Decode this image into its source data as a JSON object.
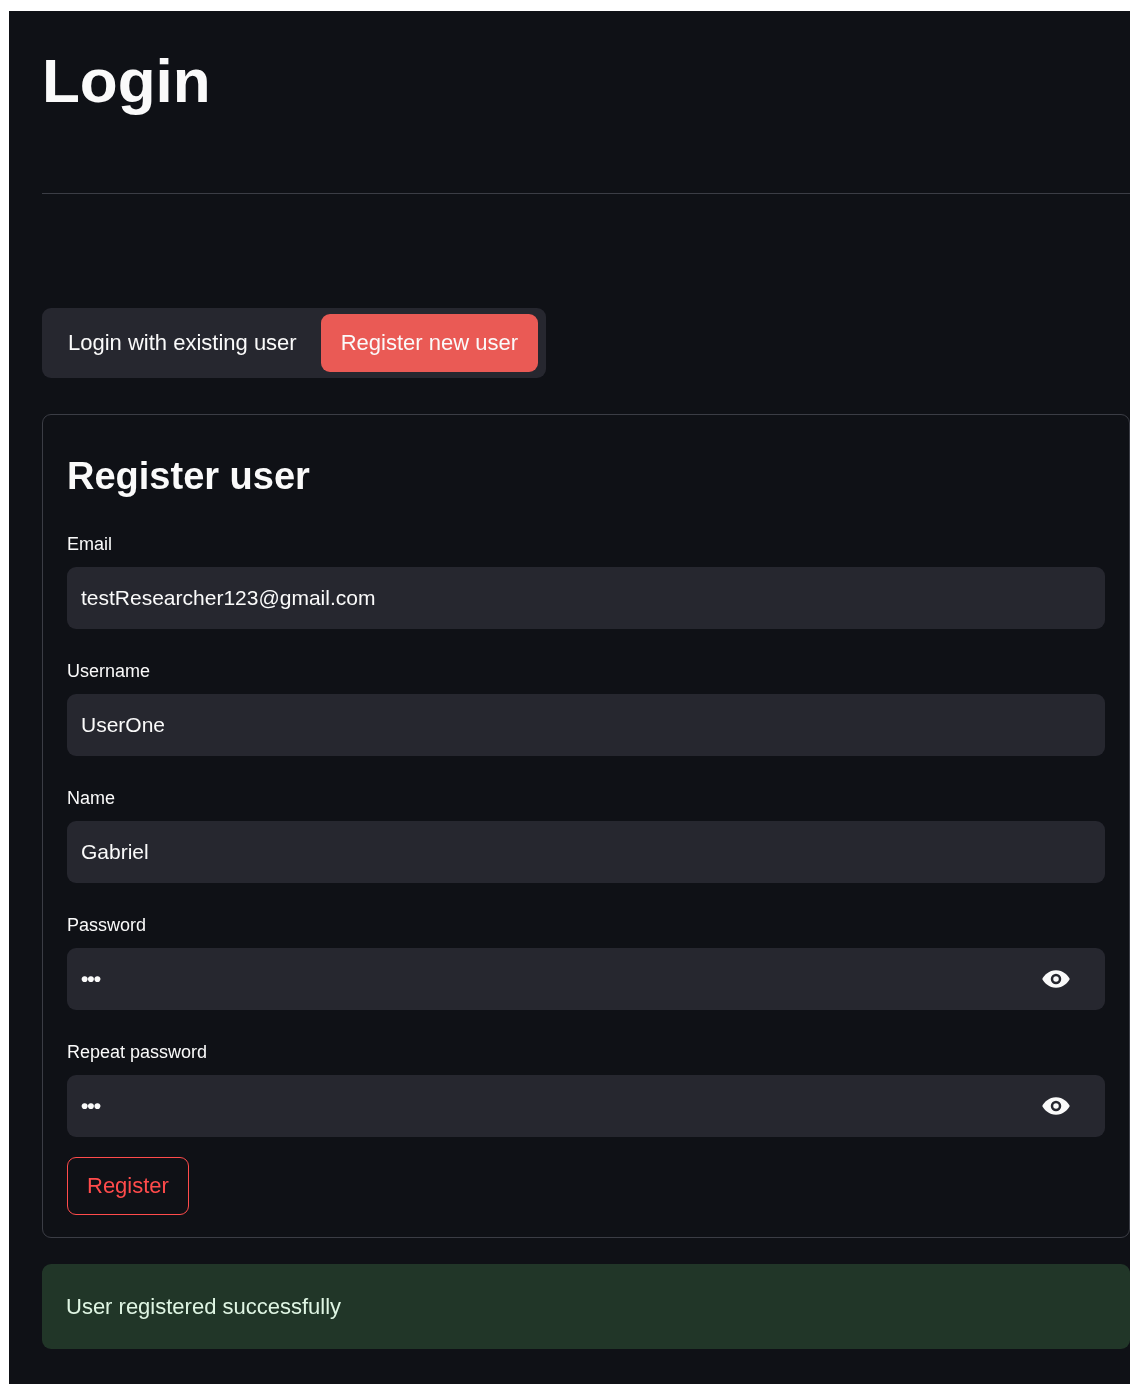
{
  "title": "Login",
  "tabs": [
    {
      "label": "Login with existing user",
      "selected": false
    },
    {
      "label": "Register new user",
      "selected": true
    }
  ],
  "form": {
    "heading": "Register user",
    "fields": [
      {
        "kind": "text",
        "label": "Email",
        "value": "testResearcher123@gmail.com"
      },
      {
        "kind": "text",
        "label": "Username",
        "value": "UserOne"
      },
      {
        "kind": "text",
        "label": "Name",
        "value": "Gabriel"
      },
      {
        "kind": "password",
        "label": "Password",
        "value": "•••"
      },
      {
        "kind": "password",
        "label": "Repeat password",
        "value": "•••"
      }
    ],
    "submit": "Register"
  },
  "message": {
    "kind": "success",
    "text": "User registered successfully"
  }
}
